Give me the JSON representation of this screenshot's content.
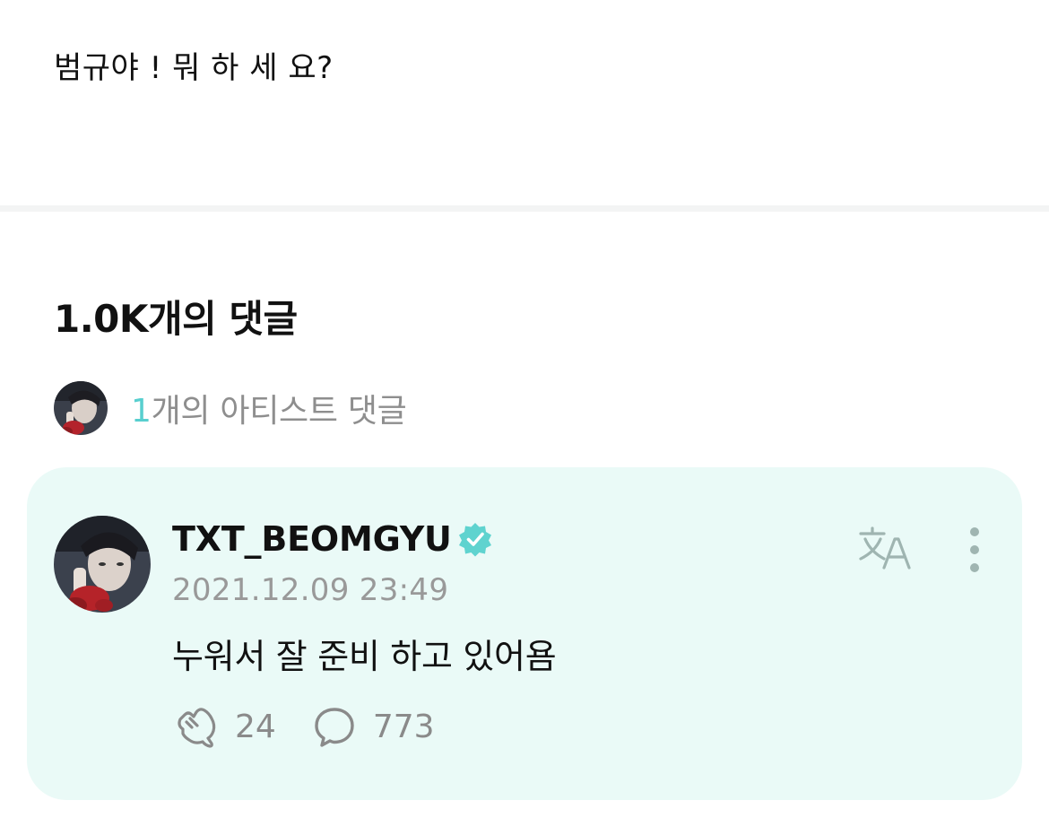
{
  "post": {
    "text": "범규야 ! 뭐 하 세 요?"
  },
  "comments": {
    "heading": "1.0K개의 댓글",
    "artist_summary": {
      "count": "1",
      "label": "개의 아티스트 댓글"
    }
  },
  "artist_comment": {
    "author": "TXT_BEOMGYU",
    "verified": true,
    "timestamp": "2021.12.09 23:49",
    "body": "누워서 잘 준비 하고 있어욤",
    "cheer_count": "24",
    "reply_count": "773"
  },
  "icons": {
    "avatar": "avatar-image",
    "verified": "verified-badge-icon",
    "translate": "translate-icon",
    "more": "more-vertical-icon",
    "cheer": "cheer-icon",
    "reply": "reply-bubble-icon"
  },
  "colors": {
    "accent": "#58cfcf",
    "card_background": "#eafaf7",
    "muted_text": "#8e8e8e",
    "divider": "#f3f4f4"
  }
}
